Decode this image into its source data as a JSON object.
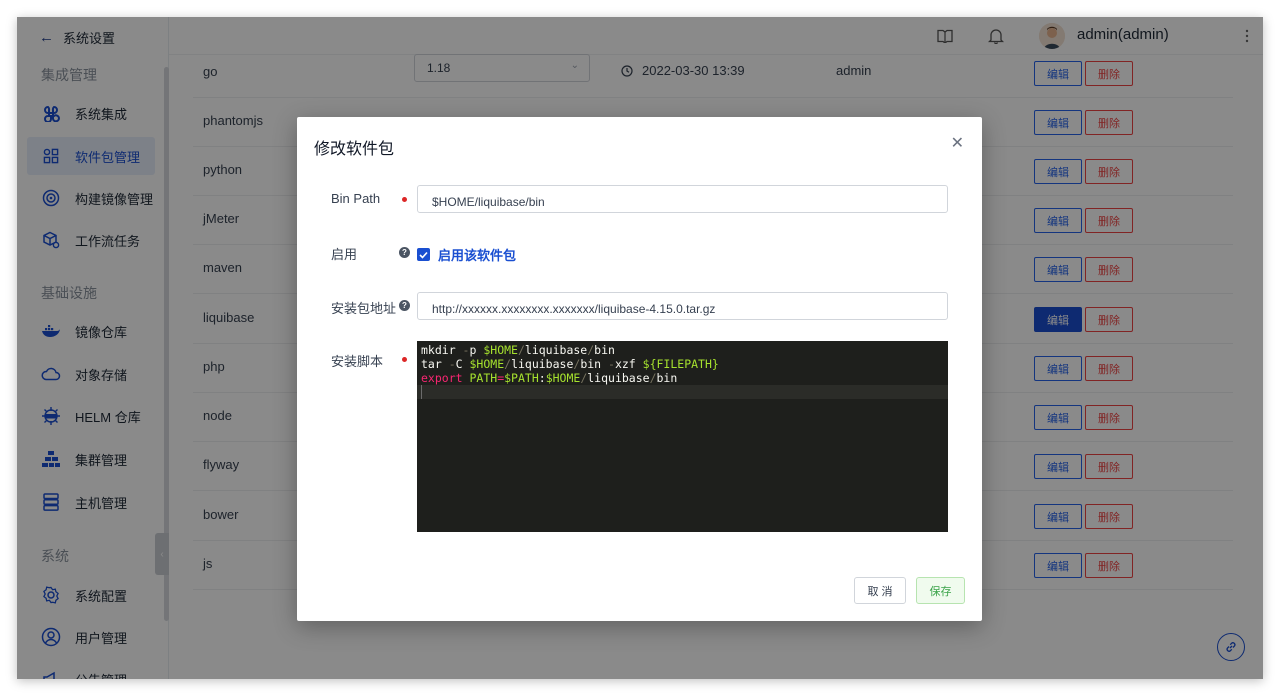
{
  "nav": {
    "back_label": "系统设置",
    "sections": [
      {
        "title": "集成管理",
        "items": [
          {
            "label": "系统集成",
            "icon": "command-icon"
          },
          {
            "label": "软件包管理",
            "icon": "package-grid-icon"
          },
          {
            "label": "构建镜像管理",
            "icon": "target-icon"
          },
          {
            "label": "工作流任务",
            "icon": "cube-gear-icon"
          }
        ]
      },
      {
        "title": "基础设施",
        "items": [
          {
            "label": "镜像仓库",
            "icon": "docker-icon"
          },
          {
            "label": "对象存储",
            "icon": "cloud-icon"
          },
          {
            "label": "HELM 仓库",
            "icon": "helm-icon"
          },
          {
            "label": "集群管理",
            "icon": "cluster-icon"
          },
          {
            "label": "主机管理",
            "icon": "server-icon"
          }
        ]
      },
      {
        "title": "系统",
        "items": [
          {
            "label": "系统配置",
            "icon": "settings-icon"
          },
          {
            "label": "用户管理",
            "icon": "user-icon"
          },
          {
            "label": "公告管理",
            "icon": "announcement-icon"
          }
        ]
      }
    ]
  },
  "header": {
    "user": "admin(admin)"
  },
  "table": {
    "edit_label": "编辑",
    "delete_label": "删除",
    "rows": [
      {
        "name": "go",
        "version": "1.18",
        "time": "2022-03-30 13:39",
        "owner": "admin"
      },
      {
        "name": "phantomjs"
      },
      {
        "name": "python"
      },
      {
        "name": "jMeter"
      },
      {
        "name": "maven"
      },
      {
        "name": "liquibase"
      },
      {
        "name": "php"
      },
      {
        "name": "node"
      },
      {
        "name": "flyway"
      },
      {
        "name": "bower"
      },
      {
        "name": "js"
      }
    ]
  },
  "dialog": {
    "title": "修改软件包",
    "bin_path_label": "Bin Path",
    "bin_path_value": "$HOME/liquibase/bin",
    "enable_label": "启用",
    "enable_checkbox_label": "启用该软件包",
    "enable_checked": true,
    "url_label": "安装包地址",
    "url_value": "http://xxxxxx.xxxxxxxx.xxxxxxx/liquibase-4.15.0.tar.gz",
    "script_label": "安装脚本",
    "cancel_label": "取 消",
    "save_label": "保存"
  },
  "colors": {
    "primary": "#1a4fd1",
    "danger": "#ef4444",
    "required": "#dc2626",
    "save_text": "#3aa349",
    "code_bg": "#1e1f1c"
  }
}
